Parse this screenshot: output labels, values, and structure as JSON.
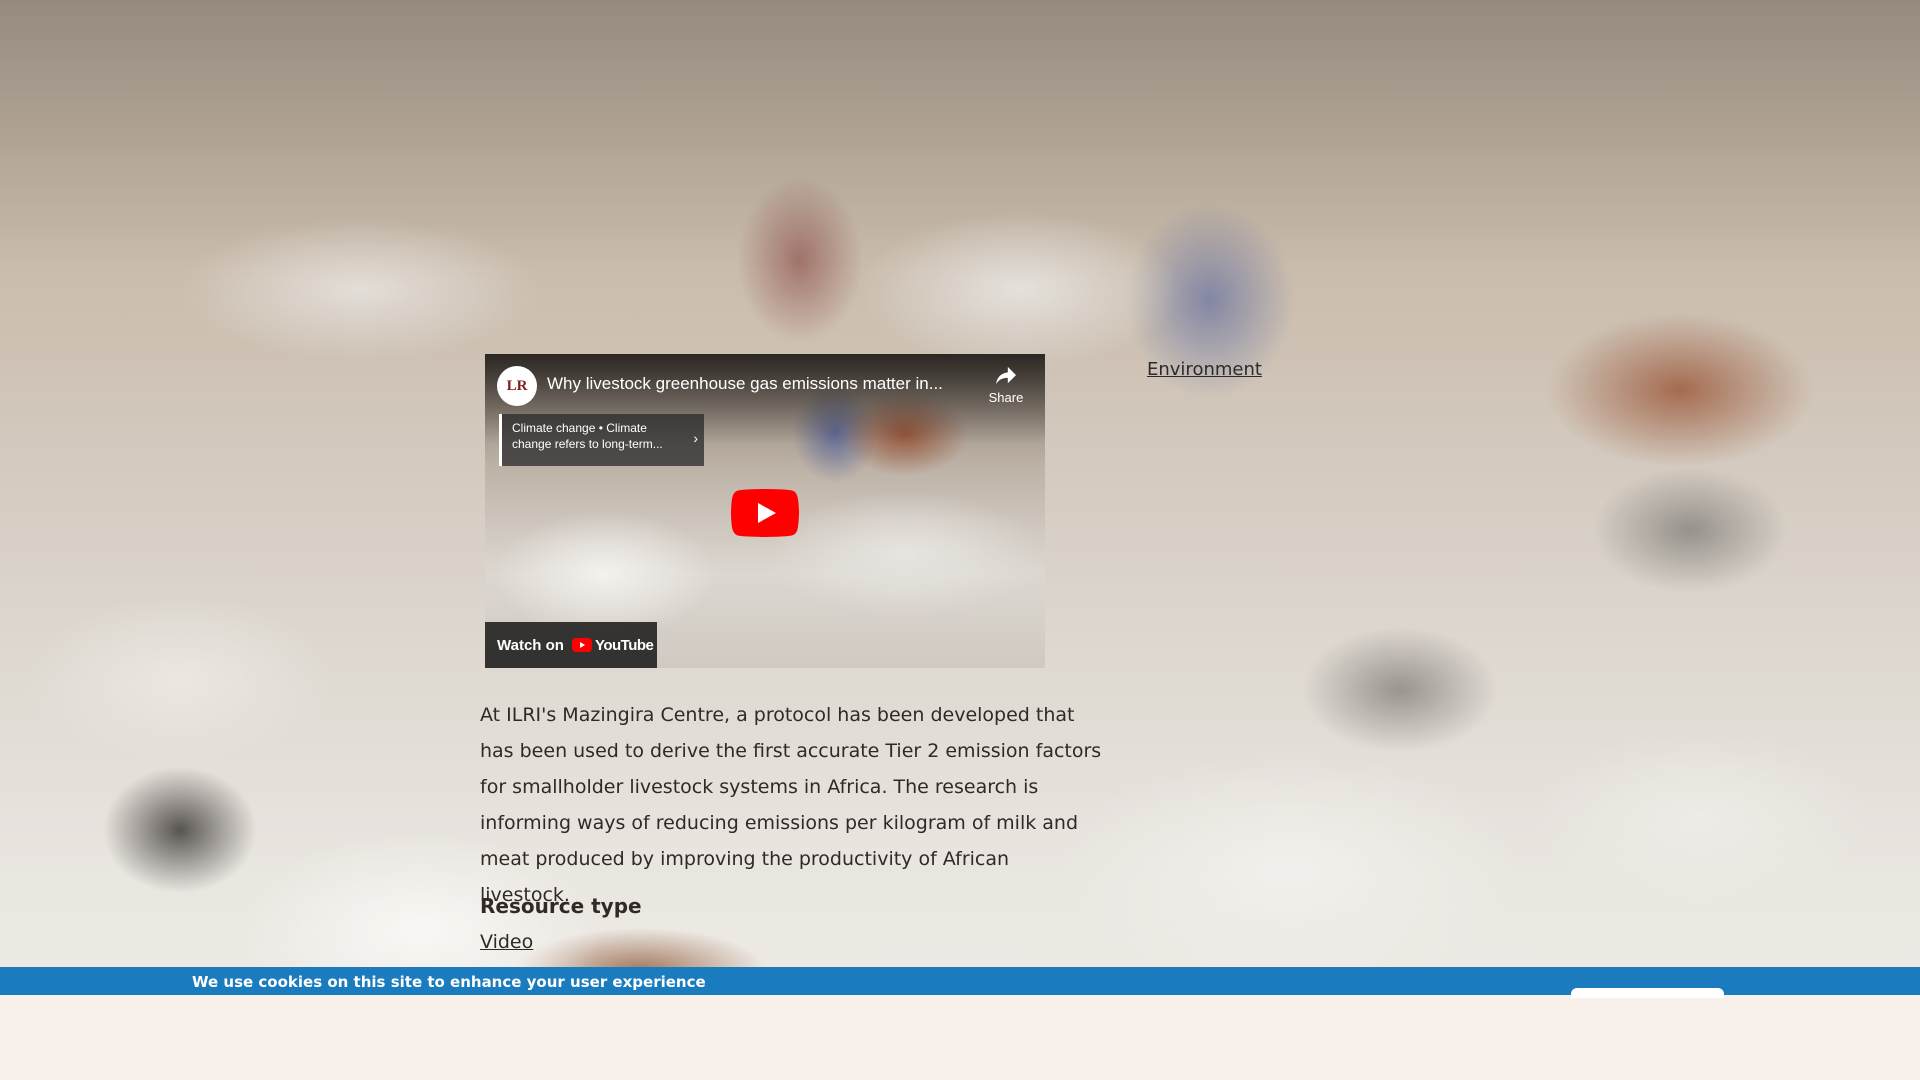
{
  "video": {
    "channel_logo_text": "LR",
    "title": "Why livestock greenhouse gas emissions matter in...",
    "share_label": "Share",
    "info_card_text": "Climate change • Climate change refers to long-term...",
    "watch_on_label": "Watch on",
    "youtube_label": "YouTube"
  },
  "environment_link": "Environment",
  "description": "At ILRI's Mazingira Centre, a protocol has been developed that has been used to derive the first accurate Tier 2 emission factors for smallholder livestock systems in Africa. The research is informing ways of reducing emissions per kilogram of milk and meat produced by improving the productivity of African livestock.",
  "resource": {
    "heading": "Resource type",
    "value": "Video"
  },
  "cookie_banner": {
    "message": "We use cookies on this site to enhance your user experience",
    "accent_color": "#1a7bbf"
  }
}
